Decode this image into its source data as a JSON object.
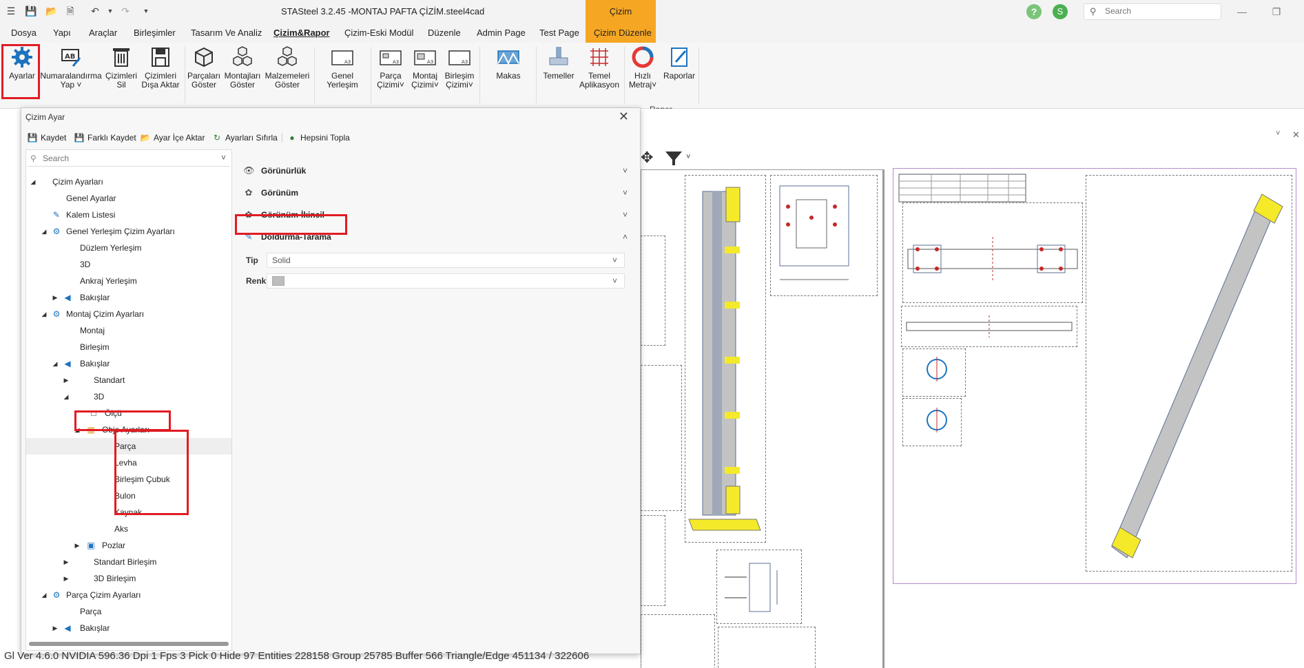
{
  "titlebar": {
    "title": "STASteel 3.2.45 -MONTAJ PAFTA ÇİZİM.steel4cad",
    "context_tab": "Çizim",
    "user_initial": "S",
    "help": "?",
    "search_placeholder": "Search"
  },
  "menu": {
    "tabs": [
      "Dosya",
      "Yapı",
      "Araçlar",
      "Birleşimler",
      "Tasarım Ve Analiz",
      "Çizim&Rapor",
      "Çizim-Eski Modül",
      "Düzenle",
      "Admin Page",
      "Test Page",
      "Çizim Düzenle"
    ],
    "active": "Çizim&Rapor"
  },
  "ribbon": {
    "buttons": [
      {
        "label": "Ayarlar"
      },
      {
        "label": "Numaralandırma Yap"
      },
      {
        "label": "Çizimleri Sil"
      },
      {
        "label": "Çizimleri Dışa Aktar"
      },
      {
        "label": "Parçaları Göster"
      },
      {
        "label": "Montajları Göster"
      },
      {
        "label": "Malzemeleri Göster"
      },
      {
        "label": "Genel Yerleşim"
      },
      {
        "label": "Parça Çizimi"
      },
      {
        "label": "Montaj Çizimi"
      },
      {
        "label": "Birleşim Çizimi"
      },
      {
        "label": "Makas"
      },
      {
        "label": "Temeller"
      },
      {
        "label": "Temel Aplikasyon"
      },
      {
        "label": "Hızlı Metraj"
      },
      {
        "label": "Raporlar"
      }
    ],
    "group_rapor": "Rapor"
  },
  "dialog": {
    "title": "Çizim Ayar",
    "toolbar": {
      "save": "Kaydet",
      "save_as": "Farklı Kaydet",
      "import": "Ayar İçe Aktar",
      "reset": "Ayarları Sıfırla",
      "collapse_all": "Hepsini Topla"
    },
    "tree_search_placeholder": "Search",
    "tree": [
      "Çizim Ayarları",
      "Genel Ayarlar",
      "Kalem Listesi",
      "Genel Yerleşim Çizim Ayarları",
      "Düzlem Yerleşim",
      "3D",
      "Ankraj Yerleşim",
      "Bakışlar",
      "Montaj Çizim Ayarları",
      "Montaj",
      "Birleşim",
      "Bakışlar",
      "Standart",
      "3D",
      "Ölçü",
      "Obje Ayarları",
      "Parça",
      "Levha",
      "Birleşim Çubuk",
      "Bulon",
      "Kaynak",
      "Aks",
      "Pozlar",
      "Standart Birleşim",
      "3D Birleşim",
      "Parça Çizim Ayarları",
      "Parça",
      "Bakışlar"
    ],
    "sections": {
      "visibility": "Görünürlük",
      "view": "Görünüm",
      "view2": "Görünüm-İkincil",
      "fill": "Doldurma-Tarama"
    },
    "props": {
      "type_label": "Tip",
      "type_value": "Solid",
      "color_label": "Renk"
    }
  },
  "status": "Gl Ver  4.6.0 NVIDIA 596.36  Dpi  1  Fps  3  Pick  0  Hide  97  Entities  228158  Group  25785  Buffer  566  Triangle/Edge  451134 / 322606",
  "colors": {
    "accent_orange": "#f5a623",
    "highlight_red": "#e11b22",
    "icon_blue": "#1e73be"
  }
}
